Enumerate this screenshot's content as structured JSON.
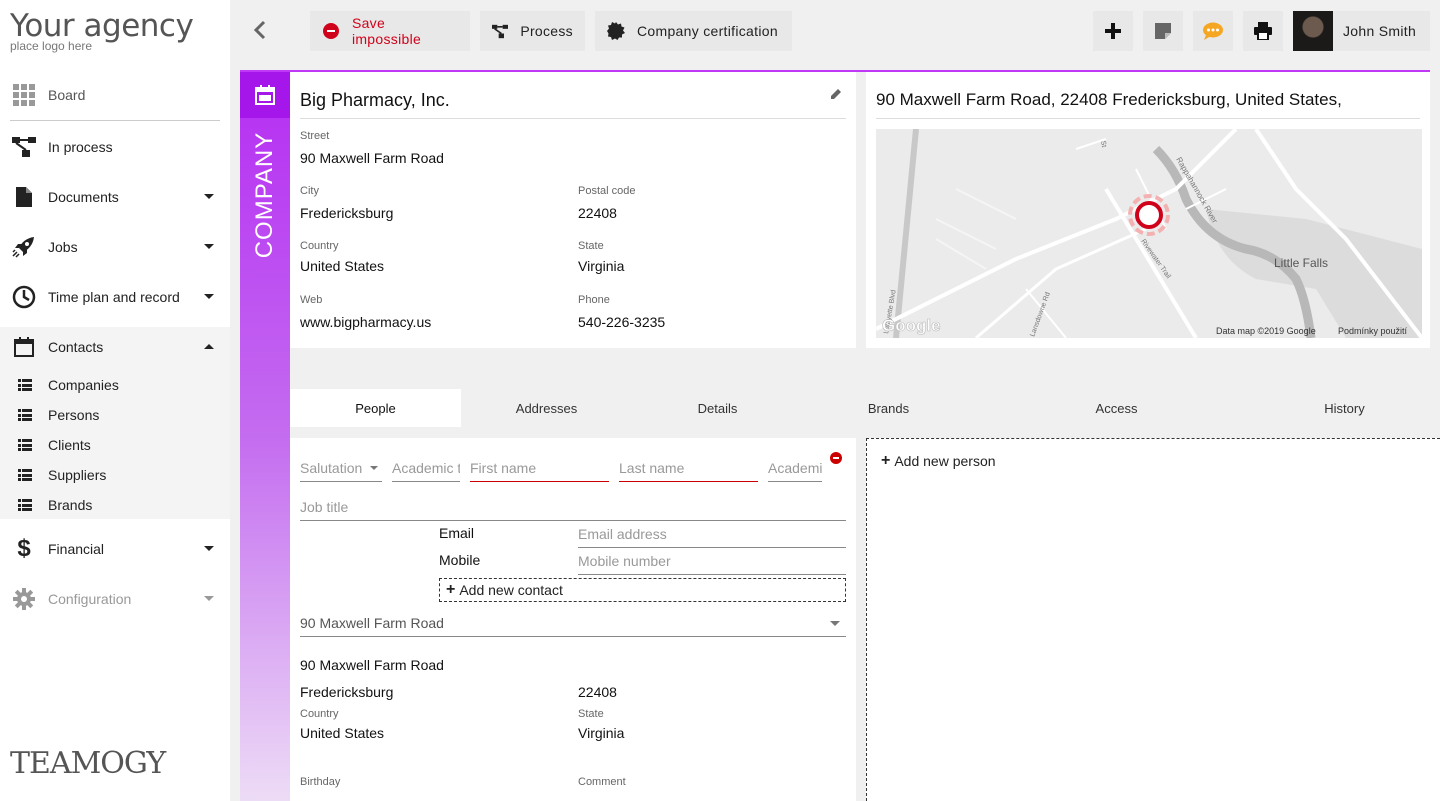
{
  "logo": {
    "main": "Your agency",
    "sub": "place logo here"
  },
  "brand": "TEAMOGY",
  "nav": {
    "board": "Board",
    "in_process": "In process",
    "documents": "Documents",
    "jobs": "Jobs",
    "time_plan": "Time plan and record",
    "contacts": "Contacts",
    "companies": "Companies",
    "persons": "Persons",
    "clients": "Clients",
    "suppliers": "Suppliers",
    "brands": "Brands",
    "financial": "Financial",
    "configuration": "Configuration"
  },
  "toolbar": {
    "save": "Save impossible",
    "process": "Process",
    "certification": "Company certification",
    "user": "John Smith"
  },
  "colors": {
    "accent": "#c038f6",
    "danger": "#d0021b",
    "chat": "#f5a623"
  },
  "company": {
    "section_label": "COMPANY",
    "name": "Big Pharmacy, Inc.",
    "street_label": "Street",
    "street": "90  Maxwell Farm Road",
    "city_label": "City",
    "city": "Fredericksburg",
    "postal_label": "Postal code",
    "postal": "22408",
    "country_label": "Country",
    "country": "United States",
    "state_label": "State",
    "state": "Virginia",
    "web_label": "Web",
    "web": "www.bigpharmacy.us",
    "phone_label": "Phone",
    "phone": "540-226-3235"
  },
  "map": {
    "title": "90 Maxwell Farm Road, 22408 Fredericksburg, United States,",
    "place": "Little Falls",
    "road1": "Rappahannock River",
    "road2": "Rivewater Trail",
    "road3": "Lafayette Blvd",
    "road4": "Lansdowne Rd",
    "road5": "St",
    "google": "Google",
    "credit": "Data map ©2019 Google",
    "terms": "Podmínky použití"
  },
  "tabs": [
    "People",
    "Addresses",
    "Details",
    "Brands",
    "Access",
    "History"
  ],
  "person_form": {
    "salutation": "Salutation",
    "academic1": "Academic t",
    "first_name": "First name",
    "last_name": "Last name",
    "academic2": "Academi",
    "job_title": "Job title",
    "email_label": "Email",
    "email_placeholder": "Email address",
    "mobile_label": "Mobile",
    "mobile_placeholder": "Mobile number",
    "add_contact": "Add new contact",
    "address_select": "90 Maxwell Farm Road",
    "street": "90  Maxwell Farm Road",
    "city": "Fredericksburg",
    "postal": "22408",
    "country_label": "Country",
    "country": "United States",
    "state_label": "State",
    "state": "Virginia",
    "birthday_label": "Birthday",
    "comment_label": "Comment"
  },
  "people": {
    "add_person": "Add new person"
  }
}
